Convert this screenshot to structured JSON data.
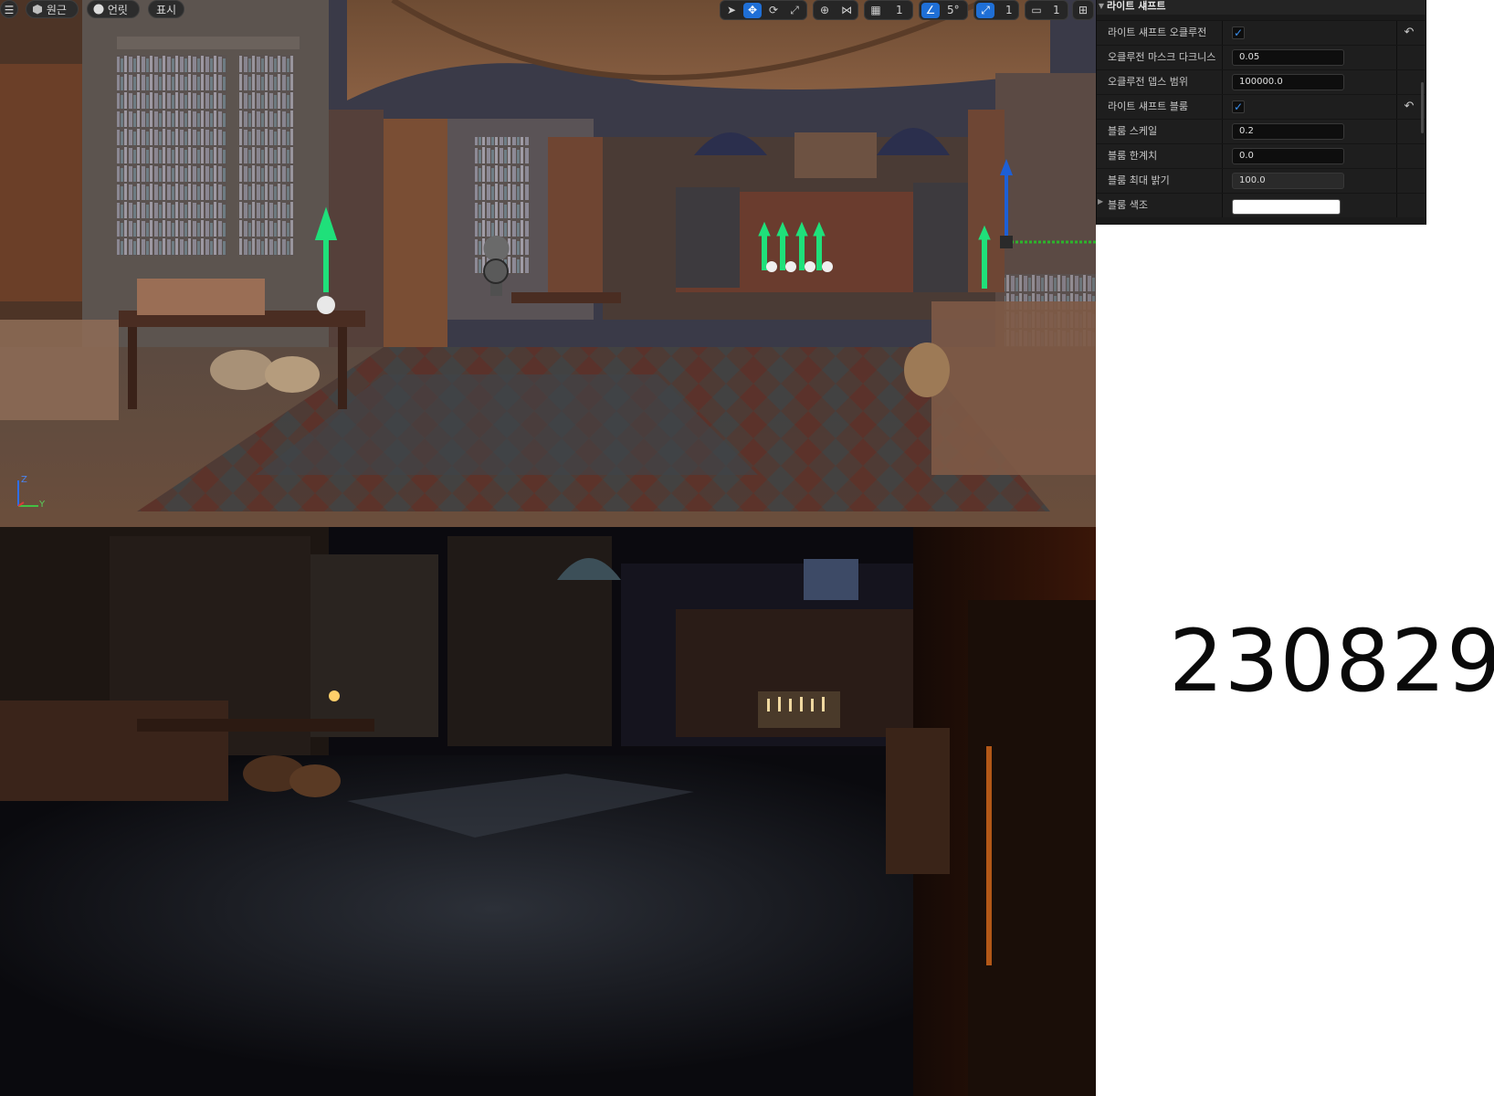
{
  "toolbar": {
    "menu_icon": "hamburger-menu-icon",
    "perspective_label": "원근",
    "lit_label": "언릿",
    "show_label": "표시",
    "grid_value": "1",
    "angle_value": "5°",
    "scale_value": "1",
    "camera_speed_value": "1"
  },
  "details": {
    "section_title": "라이트 섀프트",
    "rows": [
      {
        "label": "라이트 섀프트 오클루전",
        "type": "checkbox",
        "checked": true,
        "resettable": true
      },
      {
        "label": "오클루전 마스크 다크니스",
        "type": "number",
        "value": "0.05"
      },
      {
        "label": "오클루전 뎁스 범위",
        "type": "number",
        "value": "100000.0"
      },
      {
        "label": "라이트 섀프트 블룸",
        "type": "checkbox",
        "checked": true,
        "resettable": true
      },
      {
        "label": "블룸 스케일",
        "type": "number",
        "value": "0.2"
      },
      {
        "label": "블룸 한계치",
        "type": "number",
        "value": "0.0"
      },
      {
        "label": "블룸 최대 밝기",
        "type": "number",
        "value": "100.0",
        "disabled": true
      },
      {
        "label": "블룸 색조",
        "type": "color",
        "value": "#ffffff"
      }
    ]
  },
  "gizmo_axes": {
    "z": "Z",
    "y": "Y"
  },
  "date_label": "230829"
}
